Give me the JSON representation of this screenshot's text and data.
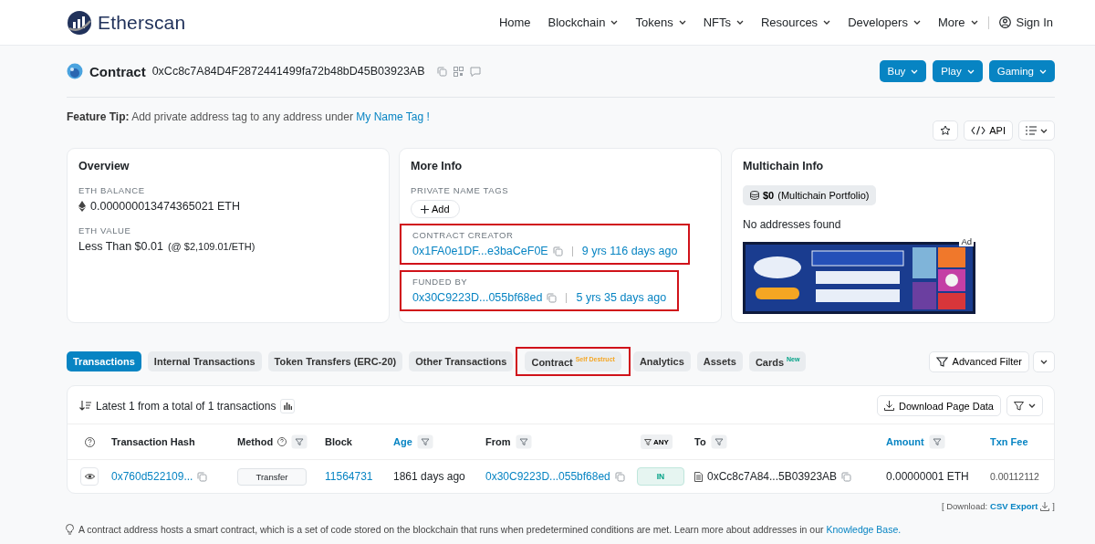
{
  "header": {
    "logo": "Etherscan",
    "nav": [
      {
        "label": "Home",
        "dropdown": false
      },
      {
        "label": "Blockchain",
        "dropdown": true
      },
      {
        "label": "Tokens",
        "dropdown": true
      },
      {
        "label": "NFTs",
        "dropdown": true
      },
      {
        "label": "Resources",
        "dropdown": true
      },
      {
        "label": "Developers",
        "dropdown": true
      },
      {
        "label": "More",
        "dropdown": true
      }
    ],
    "sign_in": "Sign In"
  },
  "contract": {
    "label": "Contract",
    "address": "0xCc8c7A84D4F2872441499fa72b48bD45B03923AB",
    "buttons": [
      "Buy",
      "Play",
      "Gaming"
    ]
  },
  "feature_tip": {
    "label": "Feature Tip:",
    "text": "Add private address tag to any address under",
    "link": "My Name Tag !"
  },
  "tools": {
    "api": "API"
  },
  "overview": {
    "title": "Overview",
    "sections": [
      {
        "label": "ETH BALANCE",
        "value": "0.000000013474365021 ETH",
        "kind": "balance"
      },
      {
        "label": "ETH VALUE",
        "value": "Less Than $0.01",
        "note": "(@ $2,109.01/ETH)",
        "kind": "value"
      }
    ]
  },
  "more_info": {
    "title": "More Info",
    "name_tags_label": "PRIVATE NAME TAGS",
    "add_button": "Add",
    "sections": [
      {
        "label": "CONTRACT CREATOR",
        "address": "0x1FA0e1DF...e3baCeF0E",
        "age": "9 yrs 116 days ago",
        "highlighted": true
      },
      {
        "label": "FUNDED BY",
        "address": "0x30C9223D...055bf68ed",
        "age": "5 yrs 35 days ago",
        "highlighted": true
      }
    ]
  },
  "multichain": {
    "title": "Multichain Info",
    "portfolio_value": "$0",
    "portfolio_note": "(Multichain Portfolio)",
    "empty": "No addresses found",
    "ad_label": "Ad"
  },
  "tabs": [
    {
      "label": "Transactions",
      "selected": true,
      "highlighted": false
    },
    {
      "label": "Internal Transactions",
      "selected": false,
      "highlighted": false
    },
    {
      "label": "Token Transfers (ERC-20)",
      "selected": false,
      "highlighted": false
    },
    {
      "label": "Other Transactions",
      "selected": false,
      "highlighted": false
    },
    {
      "label": "Contract",
      "selected": false,
      "badge": {
        "text": "Self Destruct",
        "kind": "warning"
      },
      "highlighted": true
    },
    {
      "label": "Analytics",
      "selected": false,
      "highlighted": false
    },
    {
      "label": "Assets",
      "selected": false,
      "highlighted": false
    },
    {
      "label": "Cards",
      "selected": false,
      "badge": {
        "text": "New",
        "kind": "new"
      },
      "highlighted": false
    }
  ],
  "advanced_filter": "Advanced Filter",
  "table": {
    "summary": "Latest 1 from a total of 1 transactions",
    "download": "Download Page Data",
    "columns": [
      {
        "kind": "help"
      },
      {
        "kind": "text",
        "label": "Transaction Hash",
        "link": false,
        "filter": false,
        "help": false
      },
      {
        "kind": "text",
        "label": "Method",
        "link": false,
        "filter": true,
        "help": true
      },
      {
        "kind": "text",
        "label": "Block",
        "link": false,
        "filter": false,
        "help": false
      },
      {
        "kind": "text",
        "label": "Age",
        "link": true,
        "filter": true,
        "help": false
      },
      {
        "kind": "text",
        "label": "From",
        "link": false,
        "filter": true,
        "help": false
      },
      {
        "kind": "any",
        "label": "ANY"
      },
      {
        "kind": "text",
        "label": "To",
        "link": false,
        "filter": true,
        "help": false
      },
      {
        "kind": "text",
        "label": "Amount",
        "link": true,
        "filter": true,
        "help": false
      },
      {
        "kind": "text",
        "label": "Txn Fee",
        "link": true,
        "filter": false,
        "help": false
      }
    ],
    "rows": [
      {
        "hash": "0x760d522109...",
        "method": "Transfer",
        "block": "11564731",
        "age": "1861 days ago",
        "from": "0x30C9223D...055bf68ed",
        "direction": "IN",
        "to": "0xCc8c7A84...5B03923AB",
        "amount": "0.00000001 ETH",
        "fee": "0.00112112"
      }
    ]
  },
  "export": {
    "prefix": "[ Download:",
    "link": "CSV Export",
    "suffix": "]"
  },
  "footer_note": {
    "text": "A contract address hosts a smart contract, which is a set of code stored on the blockchain that runs when predetermined conditions are met. Learn more about addresses in our",
    "link": "Knowledge Base."
  }
}
